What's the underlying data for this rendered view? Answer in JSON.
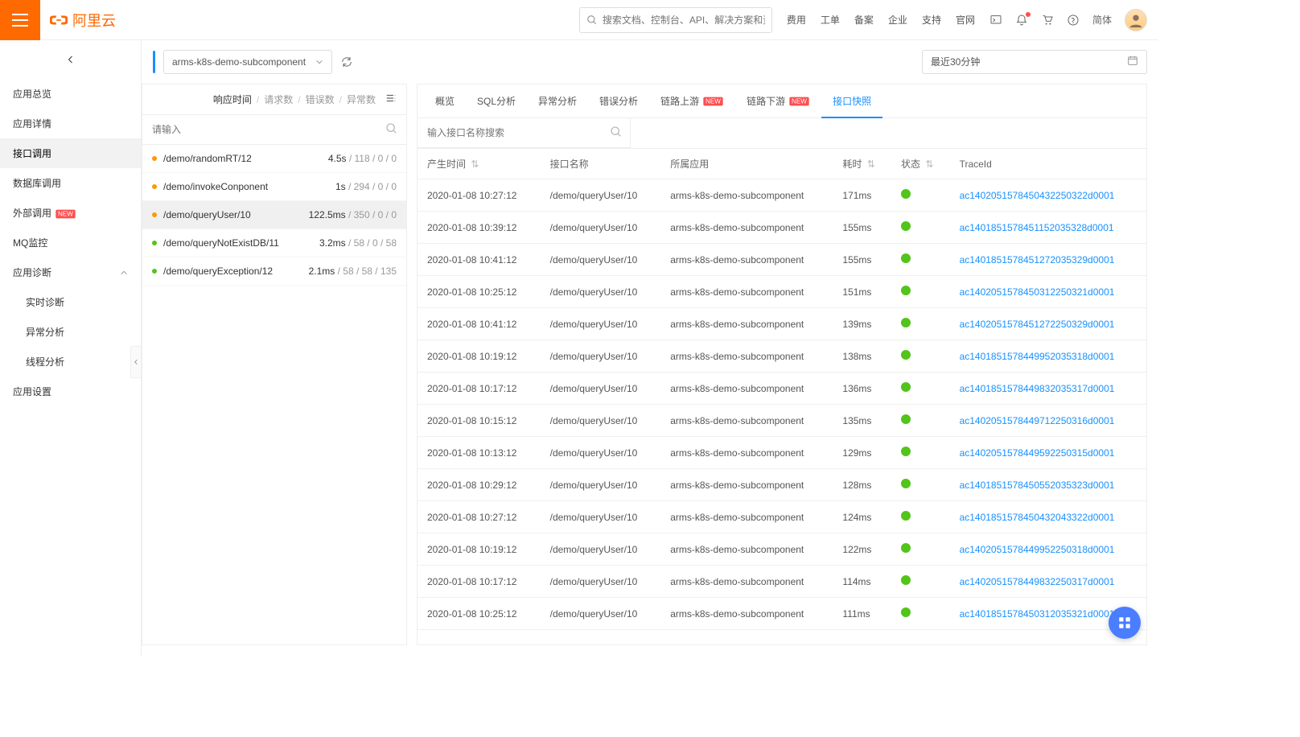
{
  "header": {
    "brand": "阿里云",
    "search_placeholder": "搜索文档、控制台、API、解决方案和资源",
    "links": [
      "费用",
      "工单",
      "备案",
      "企业",
      "支持",
      "官网"
    ],
    "lang": "简体"
  },
  "sidebar": {
    "items": [
      {
        "label": "应用总览",
        "active": false
      },
      {
        "label": "应用详情",
        "active": false
      },
      {
        "label": "接口调用",
        "active": true
      },
      {
        "label": "数据库调用",
        "active": false
      },
      {
        "label": "外部调用",
        "active": false,
        "badge": "NEW"
      },
      {
        "label": "MQ监控",
        "active": false
      },
      {
        "label": "应用诊断",
        "active": false,
        "expandable": true
      },
      {
        "label": "实时诊断",
        "active": false,
        "sub": true
      },
      {
        "label": "异常分析",
        "active": false,
        "sub": true
      },
      {
        "label": "线程分析",
        "active": false,
        "sub": true
      },
      {
        "label": "应用设置",
        "active": false
      }
    ]
  },
  "toolbar": {
    "app_name": "arms-k8s-demo-subcomponent",
    "timerange": "最近30分钟"
  },
  "left_panel": {
    "metrics": [
      "响应时间",
      "请求数",
      "错误数",
      "异常数"
    ],
    "active_metric": 0,
    "search_placeholder": "请输入",
    "apis": [
      {
        "dot": "orange",
        "name": "/demo/randomRT/12",
        "rt": "4.5s",
        "counts": "118 / 0 / 0",
        "selected": false
      },
      {
        "dot": "orange",
        "name": "/demo/invokeConponent",
        "rt": "1s",
        "counts": "294 / 0 / 0",
        "selected": false
      },
      {
        "dot": "orange",
        "name": "/demo/queryUser/10",
        "rt": "122.5ms",
        "counts": "350 / 0 / 0",
        "selected": true
      },
      {
        "dot": "green",
        "name": "/demo/queryNotExistDB/11",
        "rt": "3.2ms",
        "counts": "58 / 0 / 58",
        "selected": false
      },
      {
        "dot": "green",
        "name": "/demo/queryException/12",
        "rt": "2.1ms",
        "counts": "58 / 58 / 135",
        "selected": false
      }
    ]
  },
  "right_panel": {
    "tabs": [
      "概览",
      "SQL分析",
      "异常分析",
      "错误分析",
      "链路上游",
      "链路下游",
      "接口快照"
    ],
    "tabs_badge": {
      "4": "NEW",
      "5": "NEW"
    },
    "active_tab": 6,
    "search_placeholder": "输入接口名称搜索",
    "columns": [
      "产生时间",
      "接口名称",
      "所属应用",
      "耗时",
      "状态",
      "TraceId"
    ],
    "rows": [
      {
        "time": "2020-01-08 10:27:12",
        "api": "/demo/queryUser/10",
        "app": "arms-k8s-demo-subcomponent",
        "cost": "171ms",
        "status": "ok",
        "trace": "ac1402051578450432250322d0001"
      },
      {
        "time": "2020-01-08 10:39:12",
        "api": "/demo/queryUser/10",
        "app": "arms-k8s-demo-subcomponent",
        "cost": "155ms",
        "status": "ok",
        "trace": "ac1401851578451152035328d0001"
      },
      {
        "time": "2020-01-08 10:41:12",
        "api": "/demo/queryUser/10",
        "app": "arms-k8s-demo-subcomponent",
        "cost": "155ms",
        "status": "ok",
        "trace": "ac1401851578451272035329d0001"
      },
      {
        "time": "2020-01-08 10:25:12",
        "api": "/demo/queryUser/10",
        "app": "arms-k8s-demo-subcomponent",
        "cost": "151ms",
        "status": "ok",
        "trace": "ac1402051578450312250321d0001"
      },
      {
        "time": "2020-01-08 10:41:12",
        "api": "/demo/queryUser/10",
        "app": "arms-k8s-demo-subcomponent",
        "cost": "139ms",
        "status": "ok",
        "trace": "ac1402051578451272250329d0001"
      },
      {
        "time": "2020-01-08 10:19:12",
        "api": "/demo/queryUser/10",
        "app": "arms-k8s-demo-subcomponent",
        "cost": "138ms",
        "status": "ok",
        "trace": "ac1401851578449952035318d0001"
      },
      {
        "time": "2020-01-08 10:17:12",
        "api": "/demo/queryUser/10",
        "app": "arms-k8s-demo-subcomponent",
        "cost": "136ms",
        "status": "ok",
        "trace": "ac1401851578449832035317d0001"
      },
      {
        "time": "2020-01-08 10:15:12",
        "api": "/demo/queryUser/10",
        "app": "arms-k8s-demo-subcomponent",
        "cost": "135ms",
        "status": "ok",
        "trace": "ac1402051578449712250316d0001"
      },
      {
        "time": "2020-01-08 10:13:12",
        "api": "/demo/queryUser/10",
        "app": "arms-k8s-demo-subcomponent",
        "cost": "129ms",
        "status": "ok",
        "trace": "ac1402051578449592250315d0001"
      },
      {
        "time": "2020-01-08 10:29:12",
        "api": "/demo/queryUser/10",
        "app": "arms-k8s-demo-subcomponent",
        "cost": "128ms",
        "status": "ok",
        "trace": "ac1401851578450552035323d0001"
      },
      {
        "time": "2020-01-08 10:27:12",
        "api": "/demo/queryUser/10",
        "app": "arms-k8s-demo-subcomponent",
        "cost": "124ms",
        "status": "ok",
        "trace": "ac1401851578450432043322d0001"
      },
      {
        "time": "2020-01-08 10:19:12",
        "api": "/demo/queryUser/10",
        "app": "arms-k8s-demo-subcomponent",
        "cost": "122ms",
        "status": "ok",
        "trace": "ac1402051578449952250318d0001"
      },
      {
        "time": "2020-01-08 10:17:12",
        "api": "/demo/queryUser/10",
        "app": "arms-k8s-demo-subcomponent",
        "cost": "114ms",
        "status": "ok",
        "trace": "ac1402051578449832250317d0001"
      },
      {
        "time": "2020-01-08 10:25:12",
        "api": "/demo/queryUser/10",
        "app": "arms-k8s-demo-subcomponent",
        "cost": "111ms",
        "status": "ok",
        "trace": "ac1401851578450312035321d0001"
      }
    ]
  }
}
